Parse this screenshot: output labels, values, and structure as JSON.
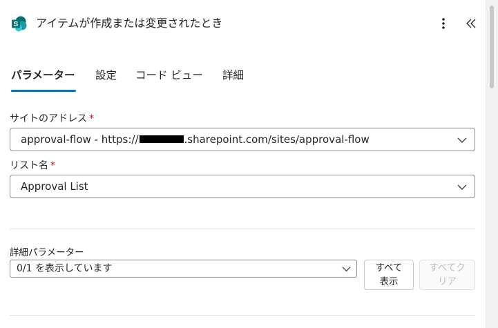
{
  "header": {
    "title": "アイテムが作成または変更されたとき",
    "app_icon": "sharepoint-logo",
    "more_icon": "more-vertical-icon",
    "collapse_icon": "double-chevron-left-icon"
  },
  "tabs": [
    {
      "label": "パラメーター",
      "active": true
    },
    {
      "label": "設定",
      "active": false
    },
    {
      "label": "コード ビュー",
      "active": false
    },
    {
      "label": "詳細",
      "active": false
    }
  ],
  "fields": {
    "site_address": {
      "label": "サイトのアドレス",
      "required_mark": "*",
      "value_prefix": "approval-flow - https://",
      "value_suffix": ".sharepoint.com/sites/approval-flow"
    },
    "list_name": {
      "label": "リスト名",
      "required_mark": "*",
      "value": "Approval List"
    }
  },
  "advanced": {
    "label": "詳細パラメーター",
    "dropdown_value": "0/1 を表示しています",
    "show_all_line1": "すべて",
    "show_all_line2": "表示",
    "clear_all_line1": "すべてク",
    "clear_all_line2": "リア"
  },
  "colors": {
    "accent": "#0f6cbd",
    "required": "#c50f1f",
    "sharepoint_teal": "#038387"
  }
}
